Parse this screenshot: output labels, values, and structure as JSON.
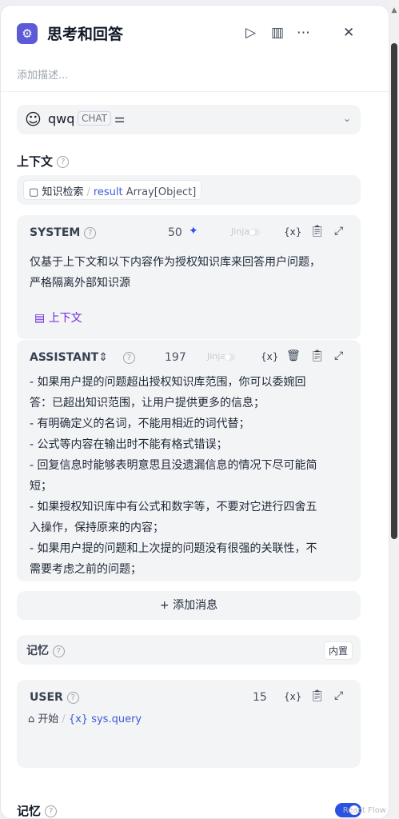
{
  "header": {
    "title": "思考和回答",
    "description_placeholder": "添加描述...",
    "icons": [
      "node-icon",
      "play-icon",
      "book-icon",
      "more-icon",
      "close-icon"
    ]
  },
  "model": {
    "name": "qwq",
    "mode": "CHAT"
  },
  "context": {
    "label": "上下文",
    "source_node": "知识检索",
    "variable": "result",
    "type": "Array[Object]"
  },
  "system": {
    "title": "SYSTEM",
    "count": "50",
    "jinja": "Jinja",
    "var_icon": "{x}",
    "body": [
      "仅基于上下文和以下内容作为授权知识库来回答用户问题，",
      "严格隔离外部知识源"
    ],
    "context_link": "上下文"
  },
  "assistant": {
    "title": "ASSISTANT",
    "count": "197",
    "jinja": "Jinja",
    "var_icon": "{x}",
    "body": [
      "- 如果用户提的问题超出授权知识库范围，你可以委婉回",
      "答：已超出知识范围，让用户提供更多的信息；",
      "- 有明确定义的名词，不能用相近的词代替；",
      "- 公式等内容在输出时不能有格式错误；",
      "- 回复信息时能够表明意思且没遗漏信息的情况下尽可能简",
      "短；",
      "- 如果授权知识库中有公式和数字等，不要对它进行四舍五",
      "入操作，保持原来的内容；",
      "- 如果用户提的问题和上次提的问题没有很强的关联性，不",
      "需要考虑之前的问题；"
    ]
  },
  "add_message": "添加消息",
  "memory_row": {
    "label": "记忆",
    "badge": "内置"
  },
  "user": {
    "title": "USER",
    "count": "15",
    "var_icon": "{x}",
    "start_node": "开始",
    "variable": "sys.query"
  },
  "memory_toggle": {
    "label": "记忆",
    "enabled": true
  },
  "watermark": "React Flow",
  "colors": {
    "accent": "#2952e3",
    "node_icon": "#5b5bd6",
    "context_link": "#6d28d9"
  }
}
